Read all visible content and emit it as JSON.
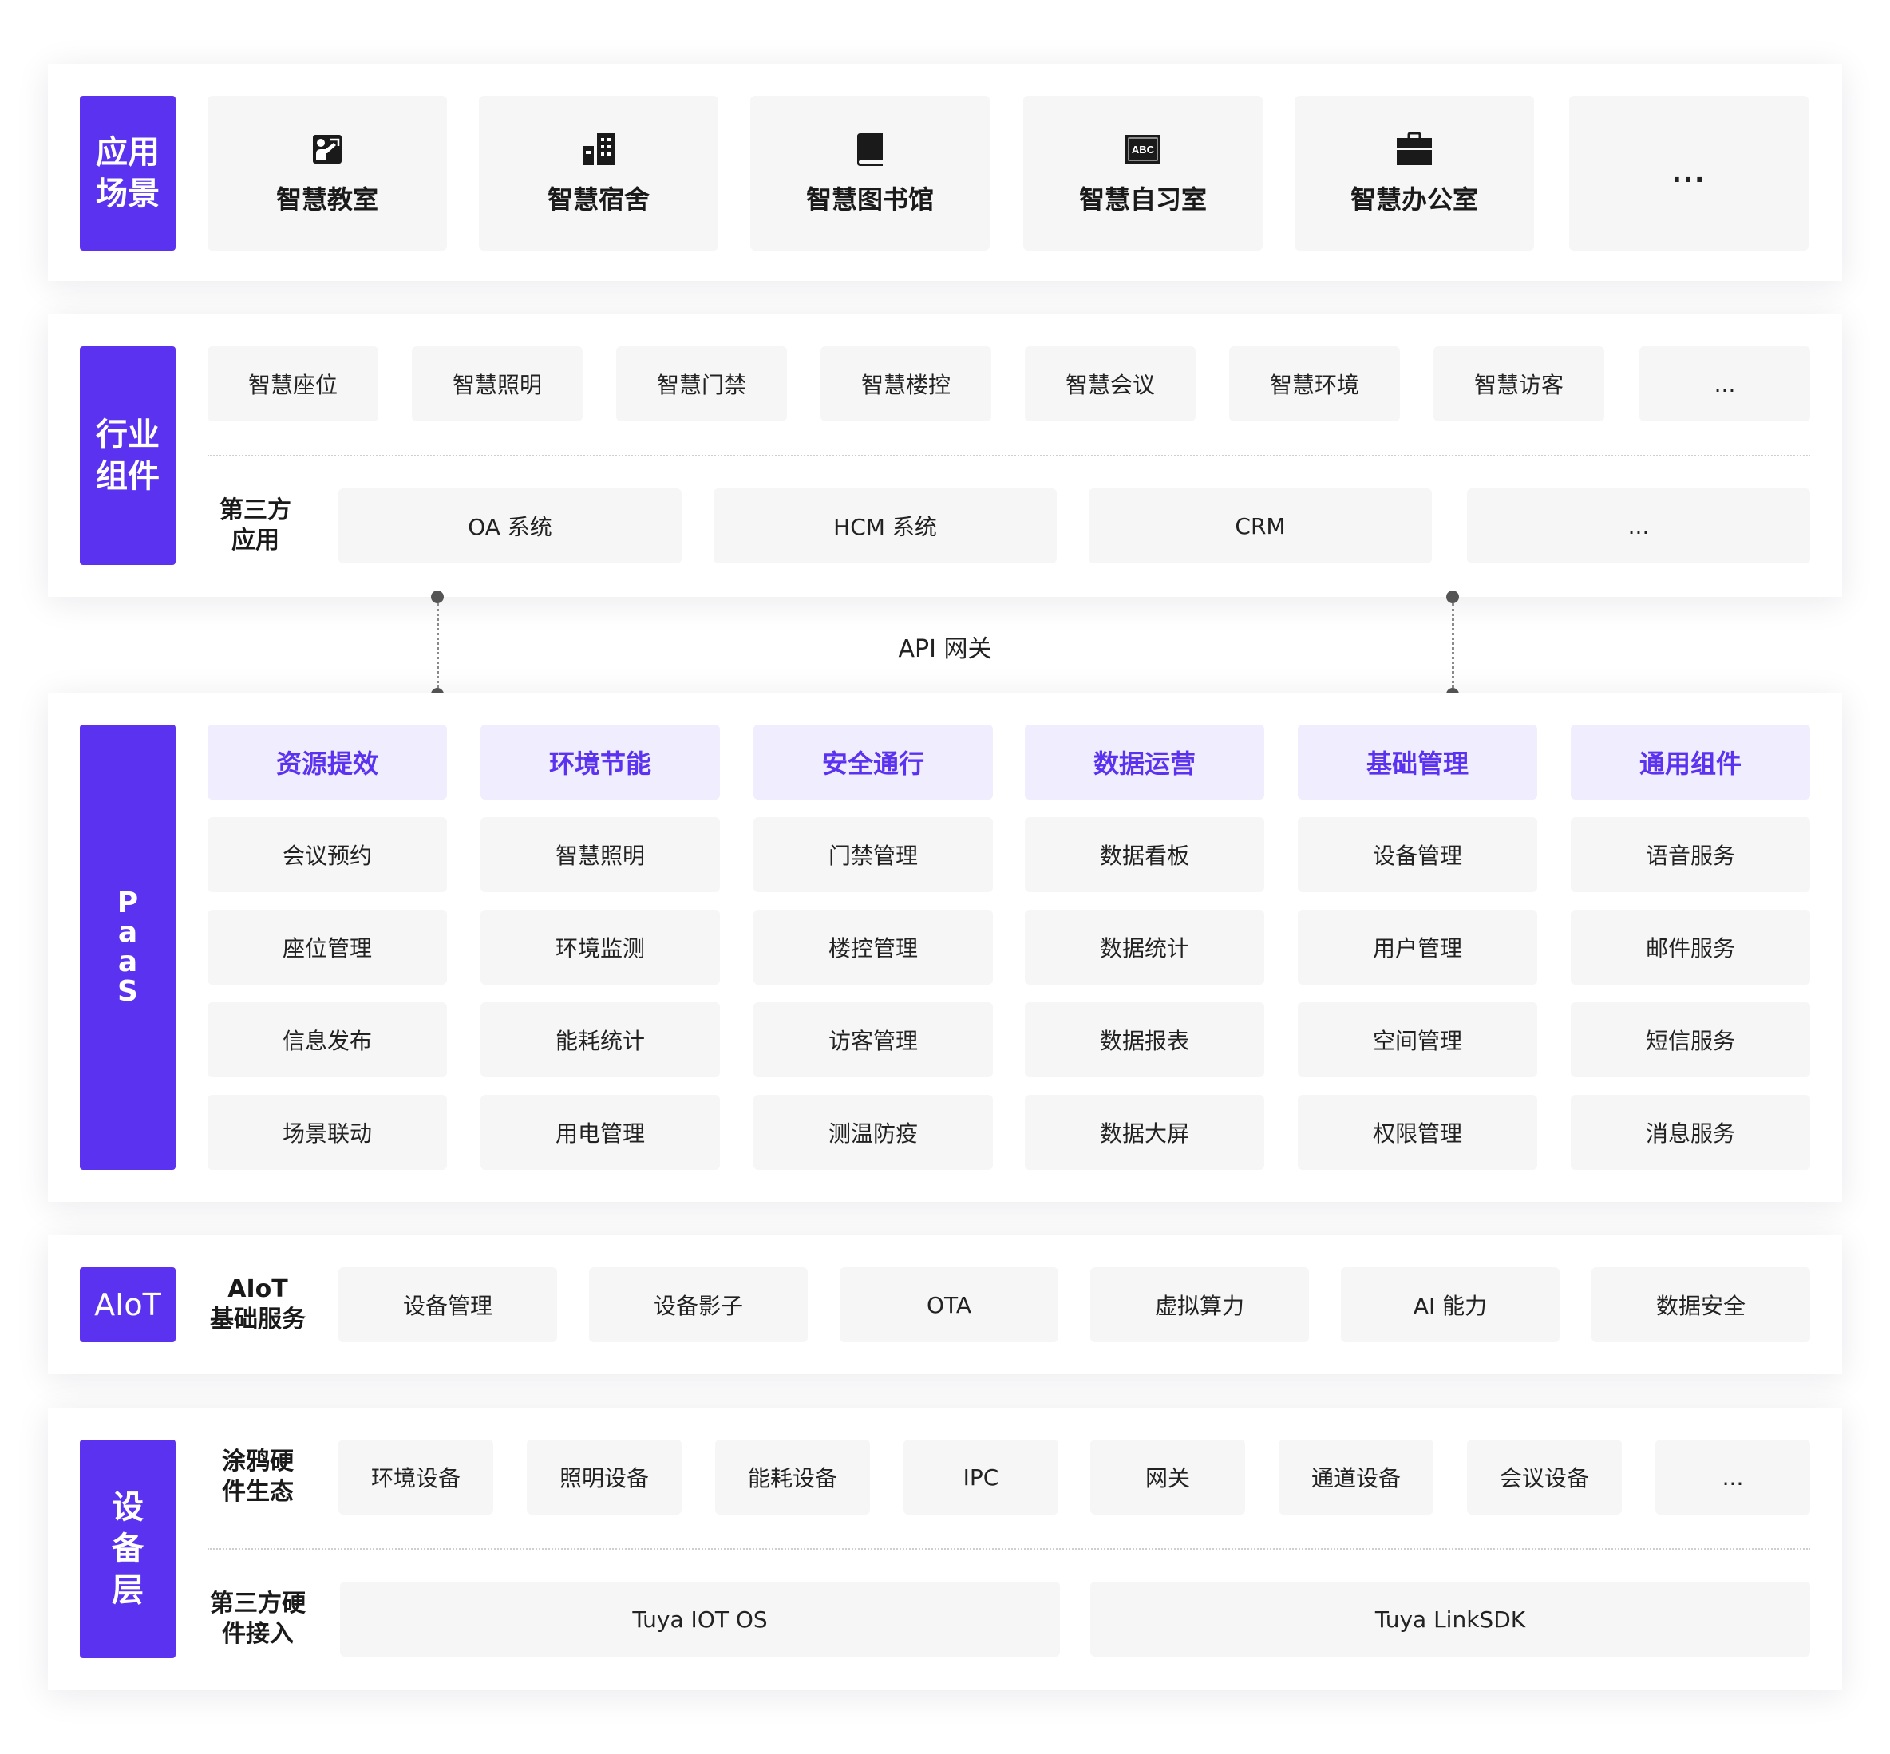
{
  "layers": {
    "application": {
      "label": "应用\n场景",
      "cards": [
        {
          "label": "智慧教室",
          "icon": "classroom-icon"
        },
        {
          "label": "智慧宿舍",
          "icon": "building-icon"
        },
        {
          "label": "智慧图书馆",
          "icon": "book-icon"
        },
        {
          "label": "智慧自习室",
          "icon": "abc-board-icon"
        },
        {
          "label": "智慧办公室",
          "icon": "briefcase-icon"
        },
        {
          "label": "...",
          "icon": ""
        }
      ]
    },
    "industry": {
      "label": "行业\n组件",
      "components": [
        "智慧座位",
        "智慧照明",
        "智慧门禁",
        "智慧楼控",
        "智慧会议",
        "智慧环境",
        "智慧访客",
        "..."
      ],
      "third_party_label": "第三方\n应用",
      "third_party": [
        "OA 系统",
        "HCM 系统",
        "CRM",
        "..."
      ]
    },
    "api_gateway": "API 网关",
    "paas": {
      "label": "P\na\na\nS",
      "columns": [
        {
          "title": "资源提效",
          "items": [
            "会议预约",
            "座位管理",
            "信息发布",
            "场景联动"
          ]
        },
        {
          "title": "环境节能",
          "items": [
            "智慧照明",
            "环境监测",
            "能耗统计",
            "用电管理"
          ]
        },
        {
          "title": "安全通行",
          "items": [
            "门禁管理",
            "楼控管理",
            "访客管理",
            "测温防疫"
          ]
        },
        {
          "title": "数据运营",
          "items": [
            "数据看板",
            "数据统计",
            "数据报表",
            "数据大屏"
          ]
        },
        {
          "title": "基础管理",
          "items": [
            "设备管理",
            "用户管理",
            "空间管理",
            "权限管理"
          ]
        },
        {
          "title": "通用组件",
          "items": [
            "语音服务",
            "邮件服务",
            "短信服务",
            "消息服务"
          ]
        }
      ]
    },
    "aiot": {
      "label": "AIoT",
      "sublabel": "AIoT\n基础服务",
      "items": [
        "设备管理",
        "设备影子",
        "OTA",
        "虚拟算力",
        "AI 能力",
        "数据安全"
      ]
    },
    "device": {
      "label": "设\n备\n层",
      "tuya_label": "涂鸦硬\n件生态",
      "tuya_items": [
        "环境设备",
        "照明设备",
        "能耗设备",
        "IPC",
        "网关",
        "通道设备",
        "会议设备",
        "..."
      ],
      "third_label": "第三方硬\n件接入",
      "third_items": [
        "Tuya IOT OS",
        "Tuya LinkSDK"
      ]
    }
  },
  "colors": {
    "accent": "#5b32ef",
    "accent_light": "#f0edfe",
    "box": "#f6f6f6"
  }
}
